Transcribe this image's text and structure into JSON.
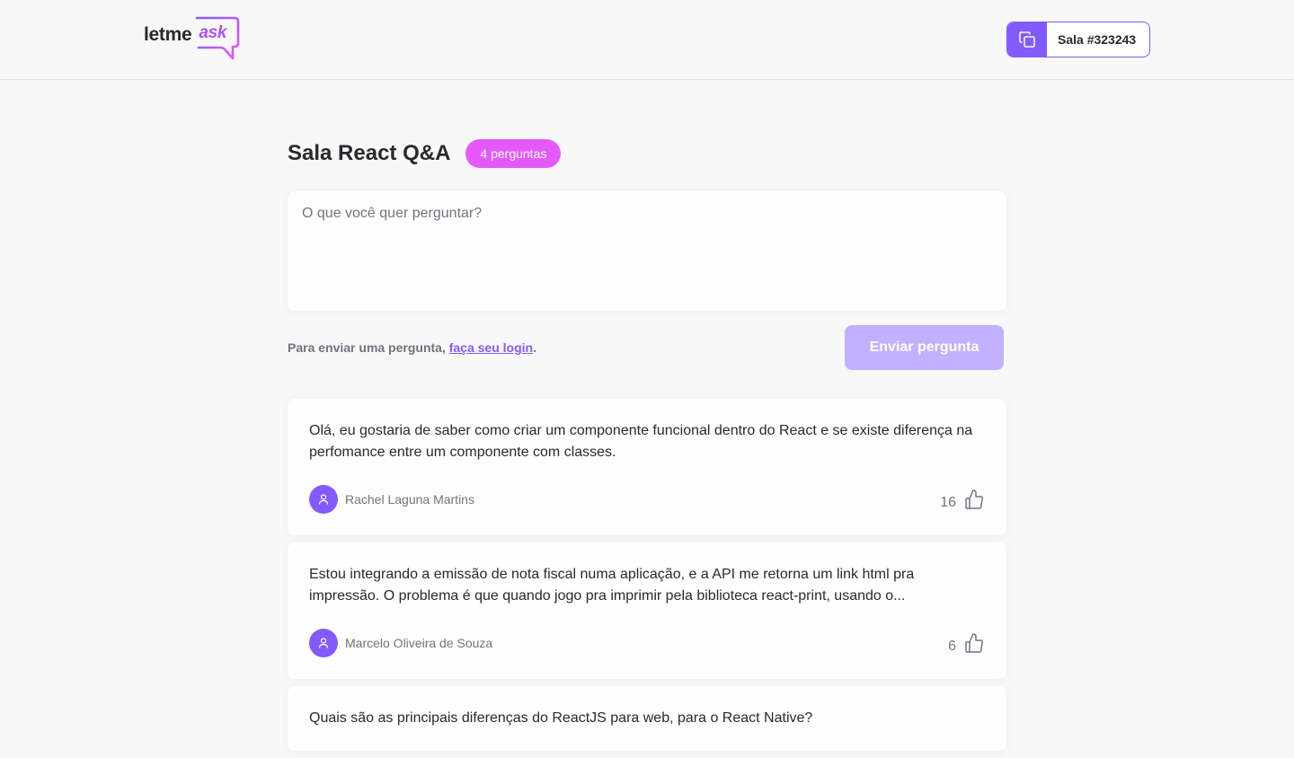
{
  "header": {
    "logo": {
      "part1": "letme",
      "part2": "ask"
    },
    "room_code_label": "Sala #323243"
  },
  "room": {
    "title": "Sala React Q&A",
    "question_count": "4 perguntas"
  },
  "form": {
    "placeholder": "O que você quer perguntar?",
    "login_prefix": "Para enviar uma pergunta, ",
    "login_link": "faça seu login",
    "login_suffix": ".",
    "submit_label": "Enviar pergunta"
  },
  "questions": [
    {
      "content": "Olá, eu gostaria de saber como criar um componente funcional dentro do React e se existe diferença na perfomance entre um componente com classes.",
      "author": "Rachel Laguna Martins",
      "likes": "16"
    },
    {
      "content": "Estou integrando a emissão de nota fiscal numa aplicação, e a API me retorna um link html pra impressão. O problema é que quando jogo pra imprimir pela biblioteca react-print, usando o...",
      "author": "Marcelo Oliveira de Souza",
      "likes": "6"
    },
    {
      "content": "Quais são as principais diferenças do ReactJS para web, para o React Native?",
      "author": "",
      "likes": ""
    }
  ],
  "colors": {
    "primary": "#835afd",
    "badge": "#e559f9",
    "button_disabled": "#c3b0fd",
    "background": "#f8f8f8"
  },
  "icons": {
    "copy": "copy-icon",
    "user": "user-icon",
    "like": "thumbs-up-icon"
  }
}
